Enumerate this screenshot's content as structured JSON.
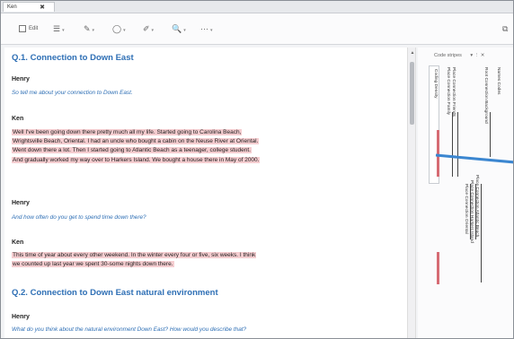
{
  "tab": {
    "title": "Ken",
    "close": "✖"
  },
  "toolbar": {
    "edit_label": "Edit",
    "items": [
      {
        "icon": "☰",
        "name": "list-icon"
      },
      {
        "icon": "✎",
        "name": "highlight-icon"
      },
      {
        "icon": "◯",
        "name": "shape-icon"
      },
      {
        "icon": "✐",
        "name": "pen-icon"
      },
      {
        "icon": "🔍",
        "name": "zoom-icon"
      },
      {
        "icon": "⋯",
        "name": "more-icon"
      }
    ],
    "right_icon": "⧉"
  },
  "document": {
    "q1": "Q.1. Connection to Down East",
    "h1_speaker": "Henry",
    "h1_text": "So tell me about your connection to Down East.",
    "k1_speaker": "Ken",
    "k1_lines": [
      "Well I've been going down there pretty much all my life. Started going to Carolina Beach,",
      "Wrightsville Beach, Oriental. I had an uncle who bought a cabin on the Neuse River at Oriental.",
      "Went down there a lot. Then I started going to Atlantic Beach as a teenager, college student.",
      "And gradually worked my way over to Harkers Island. We bought a house there in May of 2000."
    ],
    "h2_speaker": "Henry",
    "h2_text": "And how often do you get to spend time down there?",
    "k2_speaker": "Ken",
    "k2_lines": [
      "This time of year about every other weekend. In the winter every four or five, six weeks. I think",
      "we counted up last year we spent 30-some nights down there."
    ],
    "q2": "Q.2. Connection to Down East natural environment",
    "h3_speaker": "Henry",
    "h3_text": "What do you think about the natural environment Down East? How would you describe that?"
  },
  "stripes": {
    "header": "Code stripes",
    "header_icons": "▾  ⋮  ✕",
    "density_label": "Coding Density",
    "labels": [
      "Names Codes",
      "Root Connection Background",
      "Place Connection Family",
      "Place Connection Friends",
      "Place Connection Atlantic Beach",
      "Place Connection Harkers Island",
      "Place Connection Oriental"
    ],
    "colors": {
      "red": "#d66b73",
      "blue": "#3b86d0",
      "green": "#5aa36b"
    }
  }
}
